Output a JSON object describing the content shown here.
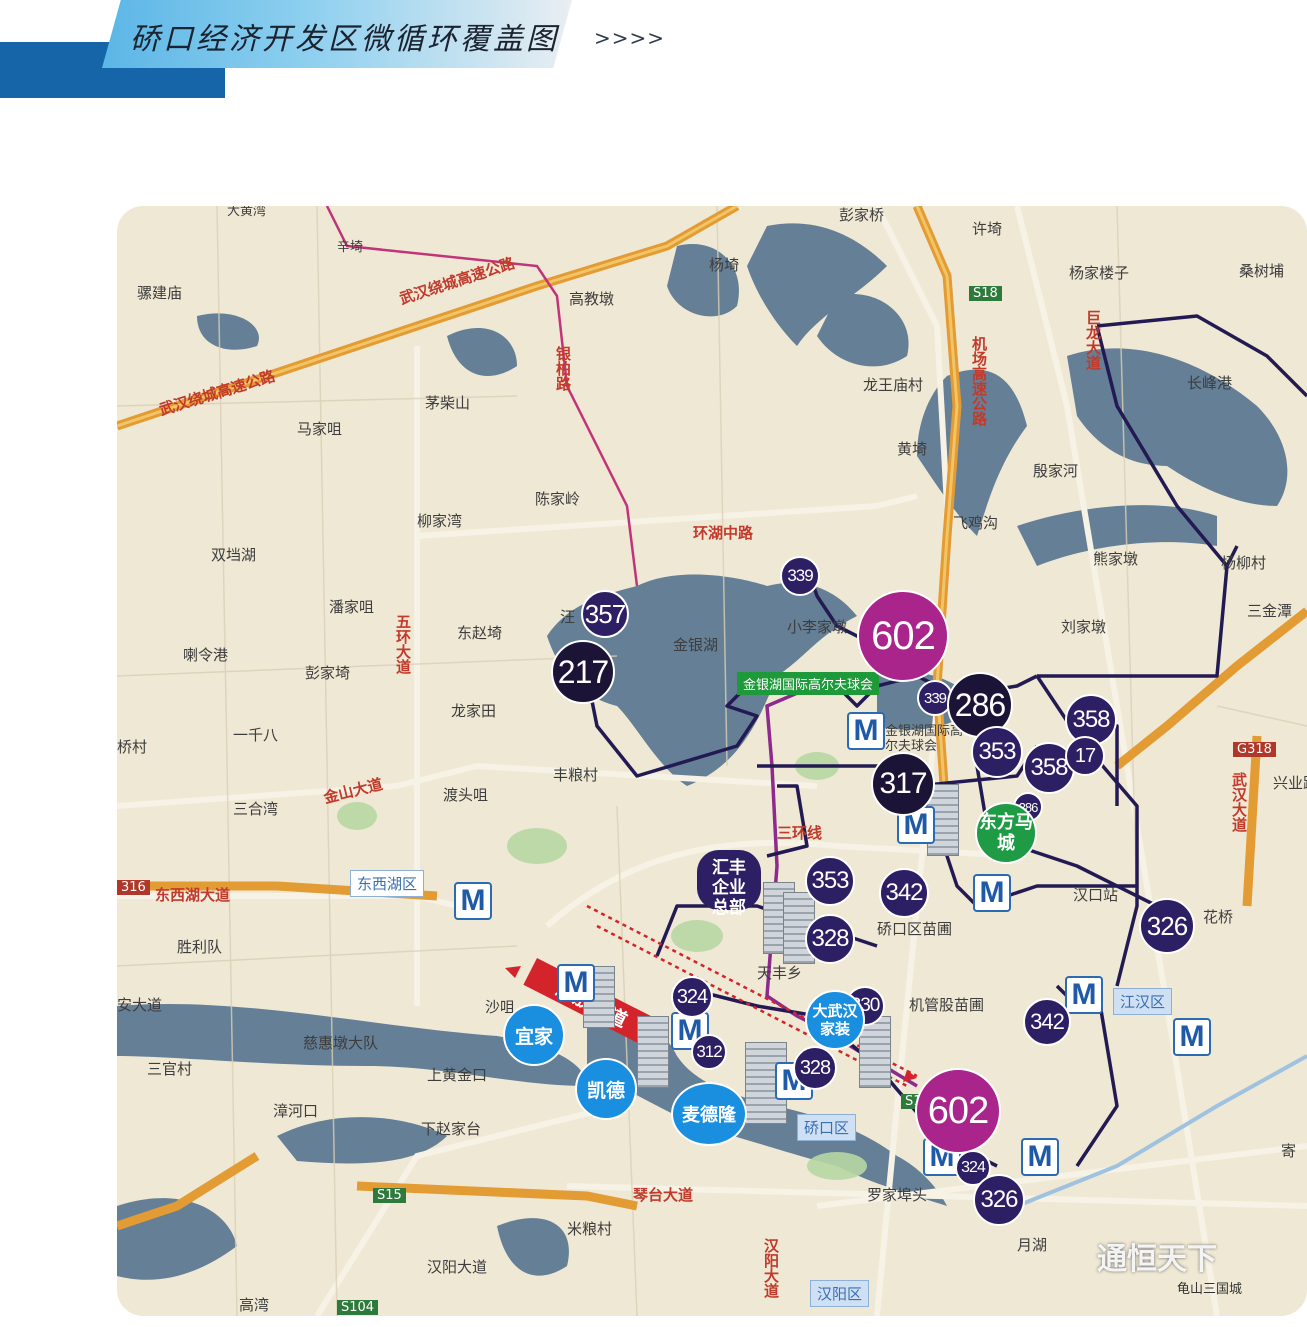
{
  "header": {
    "title": "硚口经济开发区微循环覆盖图",
    "arrows": ">>>>"
  },
  "map_labels": [
    {
      "text": "大黄湾"
    },
    {
      "text": "辛埼"
    },
    {
      "text": "骡建庙"
    },
    {
      "text": "高教墩"
    },
    {
      "text": "杨埼"
    },
    {
      "text": "彭家桥"
    },
    {
      "text": "许埼"
    },
    {
      "text": "杨家楼子"
    },
    {
      "text": "桑树埔"
    },
    {
      "text": "茅柴山"
    },
    {
      "text": "马家咀"
    },
    {
      "text": "龙王庙村"
    },
    {
      "text": "长峰港"
    },
    {
      "text": "黄埼"
    },
    {
      "text": "殷家河"
    },
    {
      "text": "陈家岭"
    },
    {
      "text": "柳家湾"
    },
    {
      "text": "飞鸡沟"
    },
    {
      "text": "双垱湖"
    },
    {
      "text": "熊家墩"
    },
    {
      "text": "杨柳村"
    },
    {
      "text": "潘家咀"
    },
    {
      "text": "东赵埼"
    },
    {
      "text": "汪"
    },
    {
      "text": "小李家墩"
    },
    {
      "text": "刘家墩"
    },
    {
      "text": "三金潭"
    },
    {
      "text": "喇令港"
    },
    {
      "text": "彭家埼"
    },
    {
      "text": "金银湖"
    },
    {
      "text": "龙家田"
    },
    {
      "text": "一千八"
    },
    {
      "text": "桥村"
    },
    {
      "text": "丰粮村"
    },
    {
      "text": "三合湾"
    },
    {
      "text": "渡头咀"
    },
    {
      "text": "胜利队"
    },
    {
      "text": "安大道"
    },
    {
      "text": "沙咀"
    },
    {
      "text": "慈惠墩大队"
    },
    {
      "text": "三官村"
    },
    {
      "text": "上黄金口"
    },
    {
      "text": "漳河口"
    },
    {
      "text": "下赵家台"
    },
    {
      "text": "罗家埠头"
    },
    {
      "text": "米粮村"
    },
    {
      "text": "汉阳大道"
    },
    {
      "text": "高湾"
    },
    {
      "text": "月湖"
    },
    {
      "text": "花桥"
    },
    {
      "text": "兴业路"
    },
    {
      "text": "硚口区苗圃"
    },
    {
      "text": "机管股苗圃"
    },
    {
      "text": "汉口站"
    },
    {
      "text": "天丰乡"
    },
    {
      "text": "寄"
    },
    {
      "text": "S18"
    },
    {
      "text": "S15"
    },
    {
      "text": "S104"
    },
    {
      "text": "G318"
    },
    {
      "text": "316"
    },
    {
      "text": "S1"
    }
  ],
  "road_labels": [
    {
      "text": "武汉绕城高速公路"
    },
    {
      "text": "环湖中路"
    },
    {
      "text": "金山大道"
    },
    {
      "text": "东西湖大道"
    },
    {
      "text": "五环大道"
    },
    {
      "text": "机场高速公路"
    },
    {
      "text": "银柏路"
    },
    {
      "text": "三环线"
    },
    {
      "text": "琴台大道"
    },
    {
      "text": "汉阳大道"
    },
    {
      "text": "武汉大道"
    },
    {
      "text": "巨龙大道"
    }
  ],
  "route_badges": [
    {
      "num": "357"
    },
    {
      "num": "217"
    },
    {
      "num": "339"
    },
    {
      "num": "602"
    },
    {
      "num": "339"
    },
    {
      "num": "286"
    },
    {
      "num": "353"
    },
    {
      "num": "358"
    },
    {
      "num": "358"
    },
    {
      "num": "17"
    },
    {
      "num": "317"
    },
    {
      "num": "286"
    },
    {
      "num": "353"
    },
    {
      "num": "342"
    },
    {
      "num": "328"
    },
    {
      "num": "326"
    },
    {
      "num": "342"
    },
    {
      "num": "324"
    },
    {
      "num": "312"
    },
    {
      "num": "328"
    },
    {
      "num": "330"
    },
    {
      "num": "602"
    },
    {
      "num": "324"
    },
    {
      "num": "326"
    }
  ],
  "places": {
    "golf": "金银湖国际高尔夫球会",
    "golf_station": "金银湖国际高尔夫球会",
    "dongfang": "东方马城",
    "huifeng": "汇丰企业总部",
    "dawuhan": "大武汉家装",
    "yijia": "宜家",
    "kaide": "凯德",
    "maidelong": "麦德隆",
    "jiefang": "解放大道",
    "dongxihu": "东西湖区",
    "jianghan": "江汉区",
    "qiaokou": "硚口区",
    "hanyang": "汉阳区"
  },
  "watermark": {
    "main": "通恒天下",
    "sub": "龟山三国城"
  },
  "colors": {
    "header_blue": "#1565a8",
    "route_dark": "#2c1f64",
    "route_pink": "#a9248b",
    "expressway": "#e79a2b",
    "water": "#5f7f98",
    "metro_blue": "#1e5aa6",
    "commerce_blue": "#1a8fe0",
    "golf_green": "#1e9a3a"
  }
}
